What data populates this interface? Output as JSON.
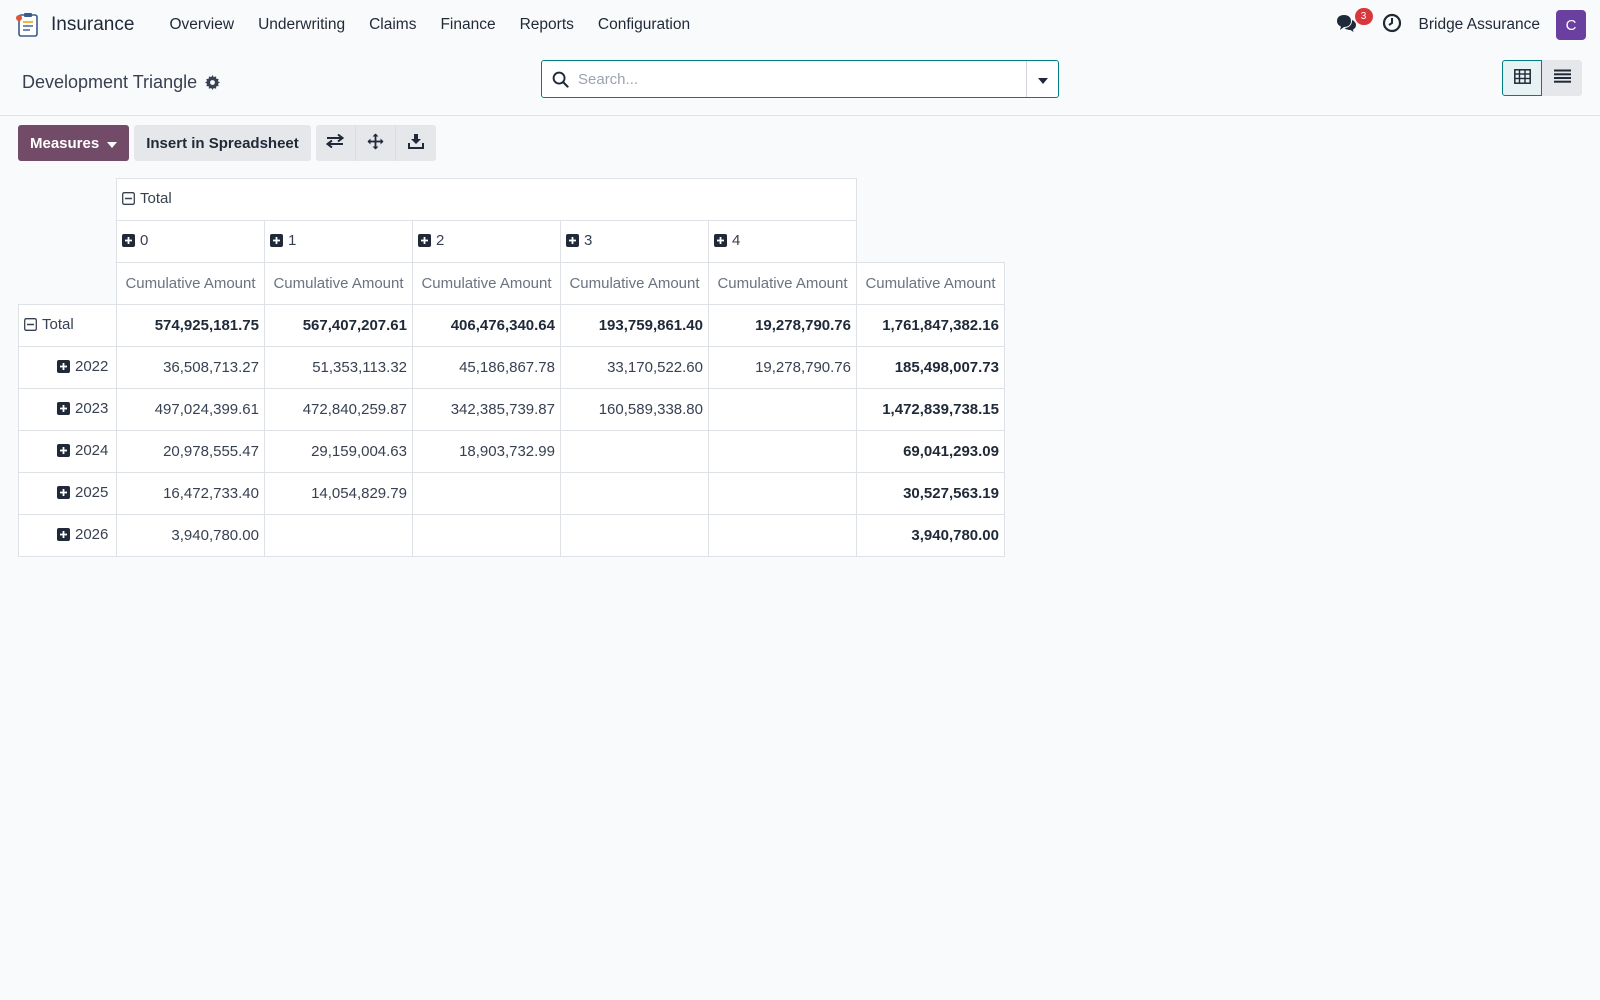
{
  "app": {
    "name": "Insurance"
  },
  "nav": {
    "items": [
      "Overview",
      "Underwriting",
      "Claims",
      "Finance",
      "Reports",
      "Configuration"
    ]
  },
  "topbar": {
    "messages_count": "3",
    "company": "Bridge Assurance",
    "avatar_letter": "C",
    "avatar_color": "#6b3fa0"
  },
  "control": {
    "title": "Development Triangle",
    "search_placeholder": "Search...",
    "accent_color": "#017e84"
  },
  "toolbar": {
    "measures_label": "Measures",
    "insert_label": "Insert in Spreadsheet",
    "brand_color": "#714b67"
  },
  "pivot": {
    "total_col_header": "Total",
    "measure_label": "Cumulative Amount",
    "columns": [
      "0",
      "1",
      "2",
      "3",
      "4"
    ],
    "total_row_label": "Total",
    "total_row_values": [
      "574,925,181.75",
      "567,407,207.61",
      "406,476,340.64",
      "193,759,861.40",
      "19,278,790.76",
      "1,761,847,382.16"
    ],
    "rows": [
      {
        "label": "2022",
        "values": [
          "36,508,713.27",
          "51,353,113.32",
          "45,186,867.78",
          "33,170,522.60",
          "19,278,790.76"
        ],
        "total": "185,498,007.73"
      },
      {
        "label": "2023",
        "values": [
          "497,024,399.61",
          "472,840,259.87",
          "342,385,739.87",
          "160,589,338.80",
          ""
        ],
        "total": "1,472,839,738.15"
      },
      {
        "label": "2024",
        "values": [
          "20,978,555.47",
          "29,159,004.63",
          "18,903,732.99",
          "",
          ""
        ],
        "total": "69,041,293.09"
      },
      {
        "label": "2025",
        "values": [
          "16,472,733.40",
          "14,054,829.79",
          "",
          "",
          ""
        ],
        "total": "30,527,563.19"
      },
      {
        "label": "2026",
        "values": [
          "3,940,780.00",
          "",
          "",
          "",
          ""
        ],
        "total": "3,940,780.00"
      }
    ]
  }
}
